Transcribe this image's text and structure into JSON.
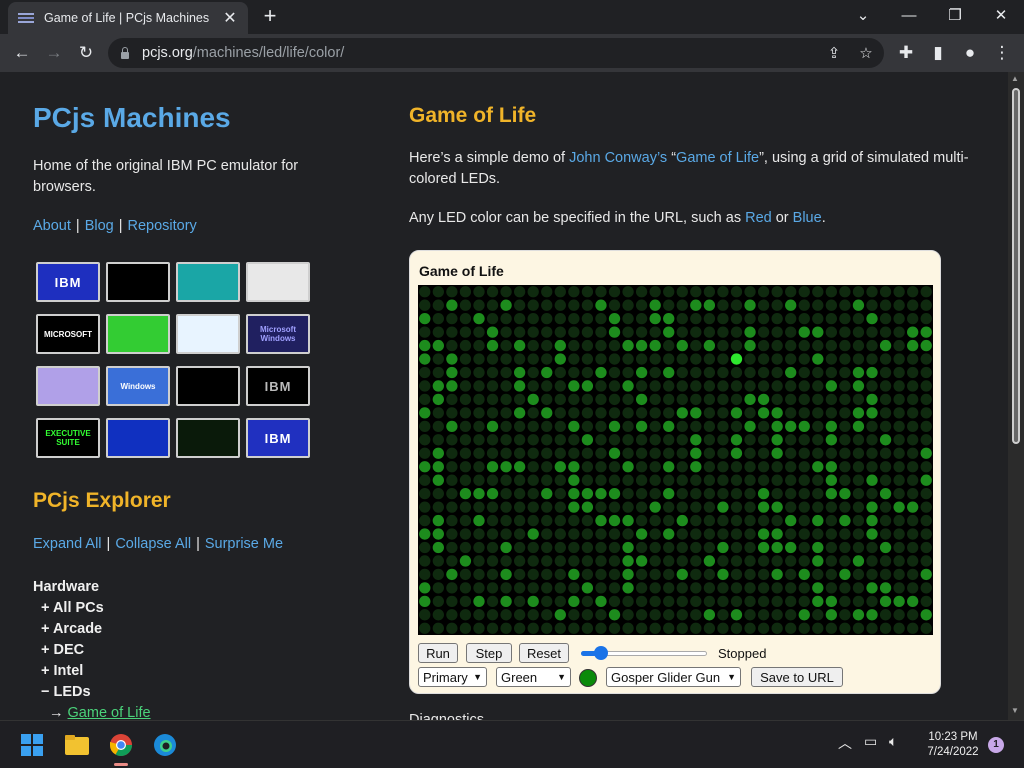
{
  "browser": {
    "tab_title": "Game of Life | PCjs Machines",
    "url_host": "pcjs.org",
    "url_path": "/machines/led/life/color/"
  },
  "sidebar": {
    "site_title": "PCjs Machines",
    "tagline": "Home of the original IBM PC emulator for browsers.",
    "nav": [
      "About",
      "Blog",
      "Repository"
    ],
    "thumbnails": [
      {
        "label": "IBM",
        "bg": "#1e2fbf",
        "fg": "#ffffff"
      },
      {
        "label": "",
        "bg": "#000000",
        "fg": "#00ff00"
      },
      {
        "label": "",
        "bg": "#1aa6a6",
        "fg": "#ffffff"
      },
      {
        "label": "",
        "bg": "#e8e8e8",
        "fg": "#000000"
      },
      {
        "label": "MICROSOFT",
        "bg": "#000000",
        "fg": "#ffffff"
      },
      {
        "label": "",
        "bg": "#33cc33",
        "fg": "#555555"
      },
      {
        "label": "",
        "bg": "#e8f4ff",
        "fg": "#1a4fb0"
      },
      {
        "label": "Microsoft Windows",
        "bg": "#202060",
        "fg": "#a0a0ff"
      },
      {
        "label": "",
        "bg": "#b0a0e8",
        "fg": "#ffffff"
      },
      {
        "label": "Windows",
        "bg": "#3a6fd8",
        "fg": "#ffffff"
      },
      {
        "label": "",
        "bg": "#000000",
        "fg": "#888888"
      },
      {
        "label": "IBM",
        "bg": "#000000",
        "fg": "#bbbbbb"
      },
      {
        "label": "EXECUTIVE SUITE",
        "bg": "#000000",
        "fg": "#33ff33"
      },
      {
        "label": "",
        "bg": "#1030c0",
        "fg": "#ffffff"
      },
      {
        "label": "",
        "bg": "#0a1a0a",
        "fg": "#44ff44"
      },
      {
        "label": "IBM",
        "bg": "#2030c0",
        "fg": "#ffffff"
      }
    ],
    "explorer_title": "PCjs Explorer",
    "explorer_links": [
      "Expand All",
      "Collapse All",
      "Surprise Me"
    ],
    "tree_heading": "Hardware",
    "tree_items": [
      "+ All PCs",
      "+ Arcade",
      "+ DEC",
      "+ Intel",
      "− LEDs"
    ],
    "tree_current_prefix": "→",
    "tree_current": "Game of Life"
  },
  "main": {
    "title": "Game of Life",
    "intro_pre": "Here’s a simple demo of ",
    "intro_link1": "John Conway’s",
    "intro_mid": " “",
    "intro_link2": "Game of Life",
    "intro_post": "”, using a grid of simulated multi-colored LEDs.",
    "color_pre": "Any LED color can be specified in the URL, such as ",
    "color_link1": "Red",
    "color_mid": " or ",
    "color_link2": "Blue",
    "color_post": ".",
    "machine_title": "Game of Life",
    "controls": {
      "run": "Run",
      "step": "Step",
      "reset": "Reset",
      "status": "Stopped",
      "speed_fraction": 0.12,
      "mode_select": "Primary",
      "color_select": "Green",
      "pattern_select": "Gosper Glider Gun",
      "save": "Save to URL"
    },
    "next_heading": "Diagnostics"
  },
  "led_colors": {
    "off": "#0f2a0f",
    "on": "#1d8c1d",
    "highlight": "#2ee82e"
  },
  "taskbar": {
    "time": "10:23 PM",
    "date": "7/24/2022",
    "notifications": "1"
  }
}
